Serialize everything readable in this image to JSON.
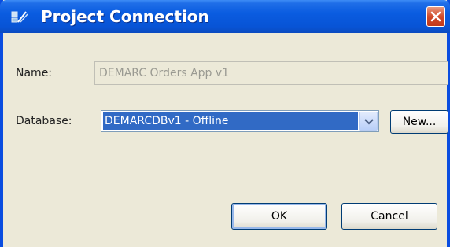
{
  "window": {
    "title": "Project Connection",
    "icon": "project-connection-icon",
    "close_icon": "close-icon"
  },
  "form": {
    "name_label": "Name:",
    "name_value": "DEMARC Orders App v1",
    "database_label": "Database:",
    "database_selected": "DEMARCDBv1 - Offline",
    "new_button": "New..."
  },
  "buttons": {
    "ok": "OK",
    "cancel": "Cancel"
  },
  "colors": {
    "titlebar": "#0a5ce0",
    "selection": "#316ac5",
    "close": "#d14a2a",
    "dialog_bg": "#ece9d8"
  }
}
